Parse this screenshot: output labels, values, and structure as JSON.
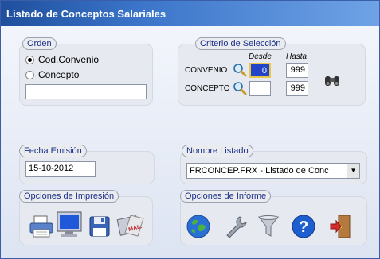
{
  "window": {
    "title": "Listado de Conceptos Salariales"
  },
  "orden": {
    "label": "Orden",
    "options": [
      "Cod.Convenio",
      "Concepto"
    ],
    "selected": "Cod.Convenio",
    "field_value": ""
  },
  "criterio": {
    "label": "Criterio de Selección",
    "col_desde": "Desde",
    "col_hasta": "Hasta",
    "rows": [
      {
        "label": "CONVENIO",
        "desde": "0",
        "hasta": "999"
      },
      {
        "label": "CONCEPTO",
        "desde": "",
        "hasta": "999"
      }
    ]
  },
  "fecha": {
    "label": "Fecha Emisión",
    "value": "15-10-2012"
  },
  "nombre": {
    "label": "Nombre Listado",
    "value": "FRCONCEP.FRX - Listado de Conc"
  },
  "impresion": {
    "label": "Opciones de Impresión",
    "icons": [
      "printer-icon",
      "monitor-icon",
      "floppy-disk-icon",
      "mail-icon"
    ]
  },
  "informe": {
    "label": "Opciones de Informe",
    "icons": [
      "globe-icon",
      "wrench-icon",
      "filter-icon",
      "help-icon",
      "exit-door-icon"
    ]
  }
}
